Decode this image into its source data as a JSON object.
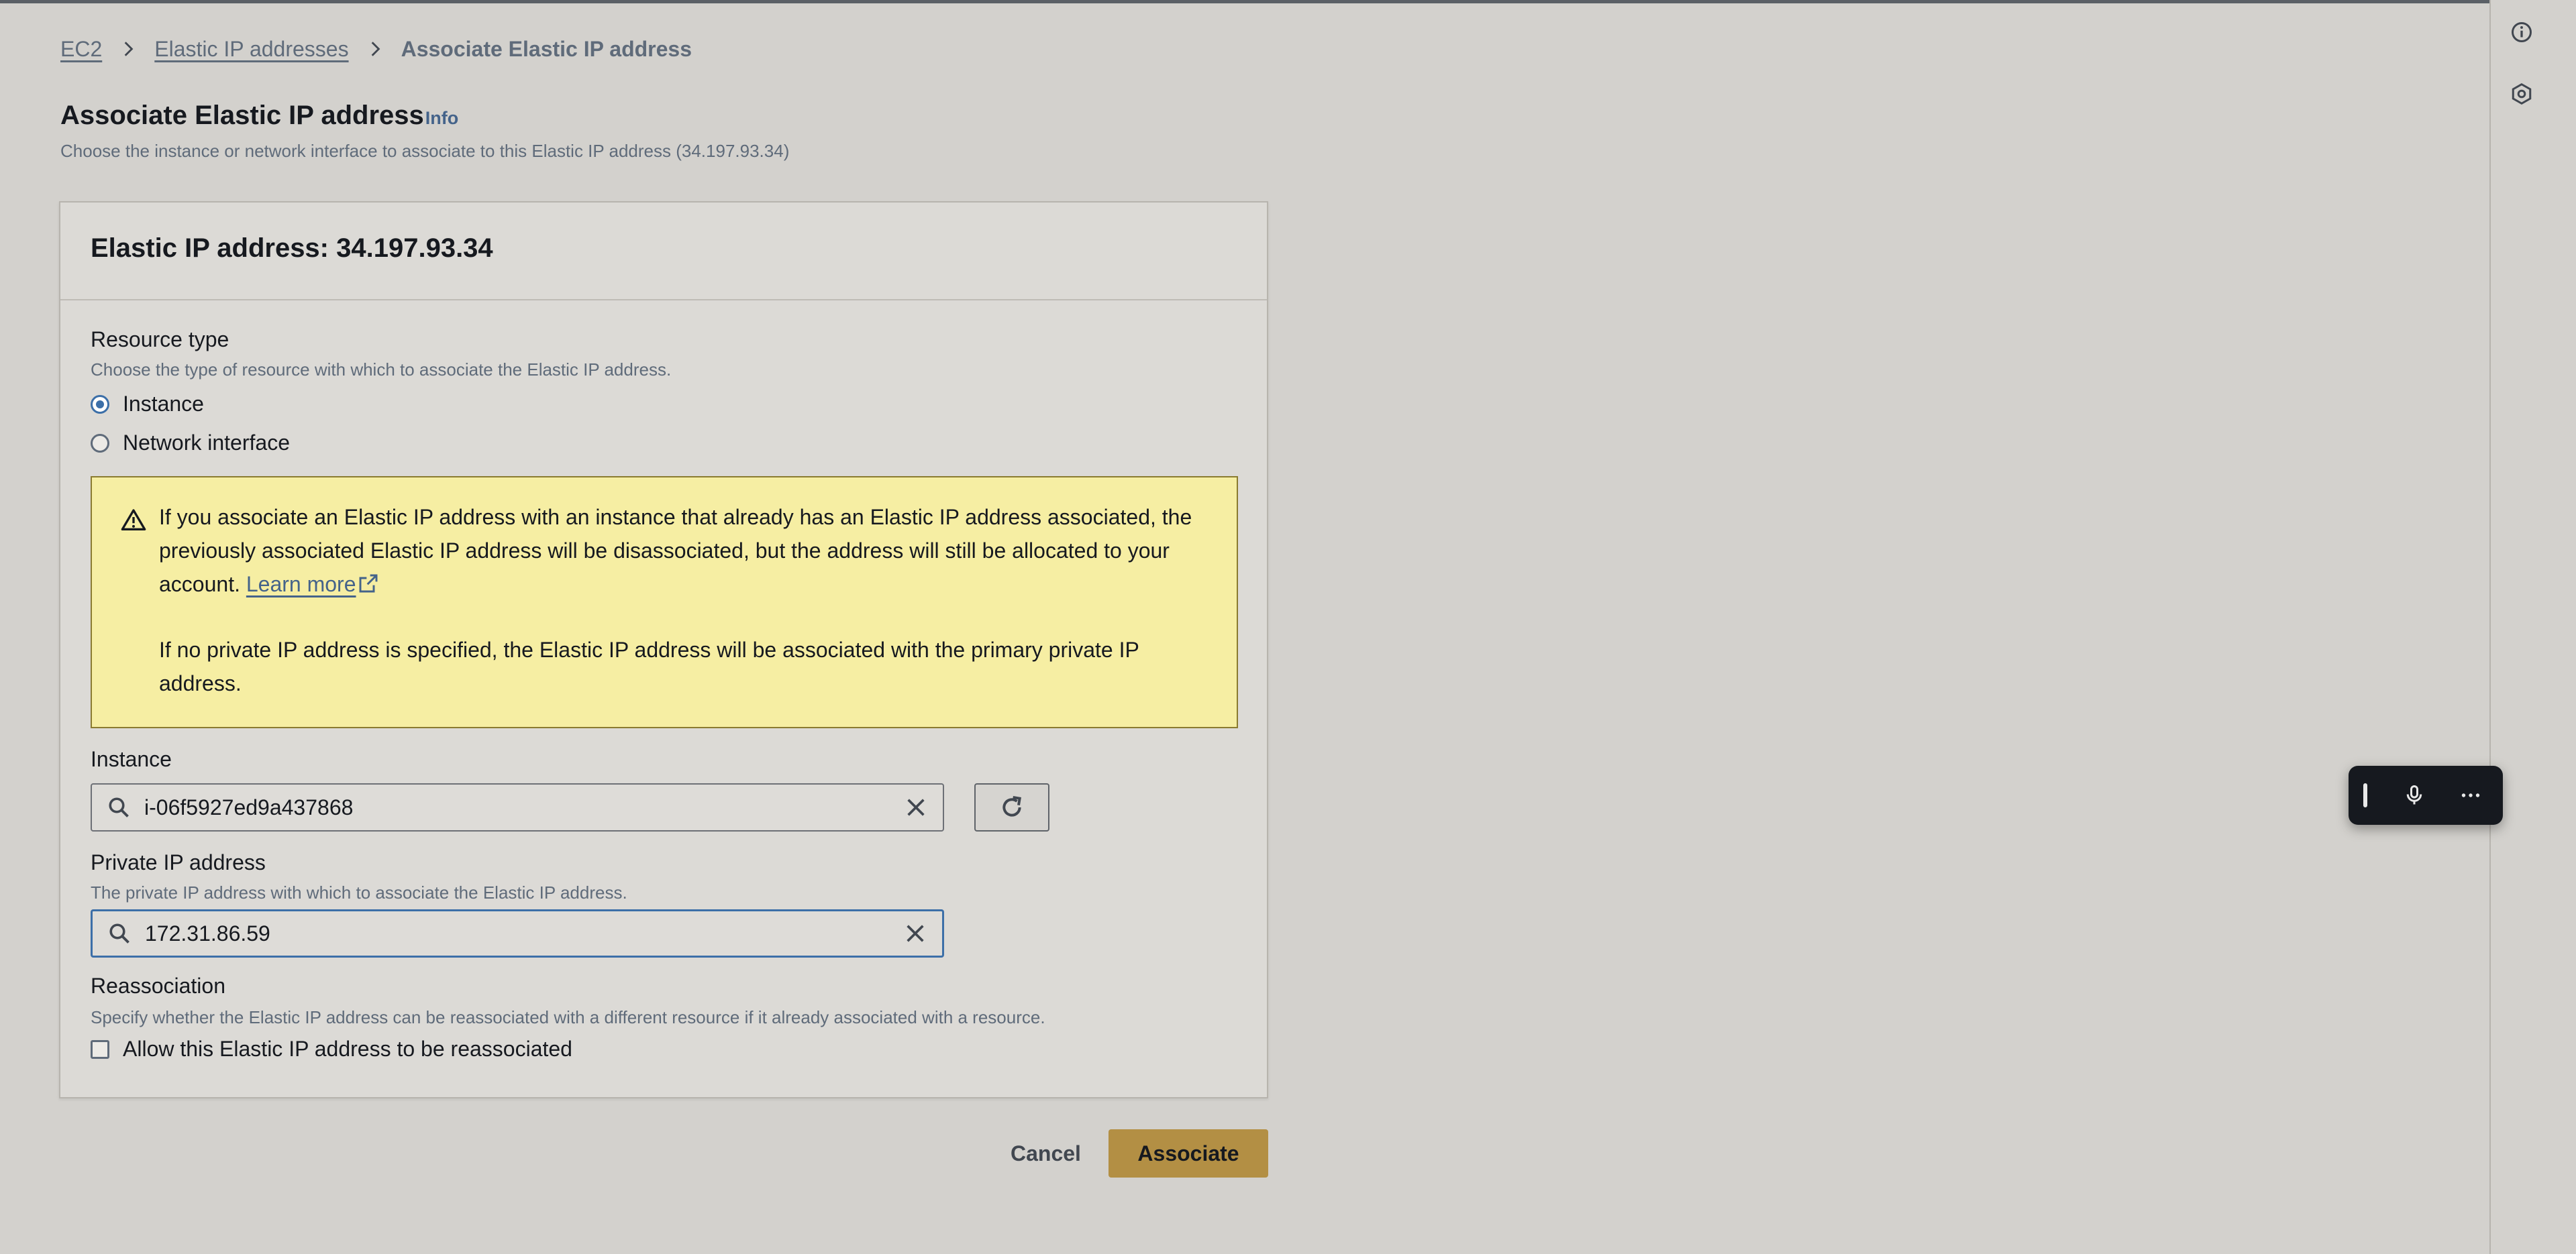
{
  "breadcrumb": {
    "items": [
      "EC2",
      "Elastic IP addresses"
    ],
    "current": "Associate Elastic IP address"
  },
  "page": {
    "title": "Associate Elastic IP address",
    "info": "Info",
    "description": "Choose the instance or network interface to associate to this Elastic IP address (34.197.93.34)"
  },
  "card": {
    "title": "Elastic IP address: 34.197.93.34"
  },
  "resource_type": {
    "label": "Resource type",
    "hint": "Choose the type of resource with which to associate the Elastic IP address.",
    "options": [
      {
        "label": "Instance",
        "selected": true
      },
      {
        "label": "Network interface",
        "selected": false
      }
    ]
  },
  "alert": {
    "text1": "If you associate an Elastic IP address with an instance that already has an Elastic IP address associated, the previously associated Elastic IP address will be disassociated, but the address will still be allocated to your account.",
    "link": "Learn more",
    "text2": "If no private IP address is specified, the Elastic IP address will be associated with the primary private IP address."
  },
  "instance": {
    "label": "Instance",
    "value": "i-06f5927ed9a437868"
  },
  "private_ip": {
    "label": "Private IP address",
    "hint": "The private IP address with which to associate the Elastic IP address.",
    "value": "172.31.86.59"
  },
  "reassociation": {
    "label": "Reassociation",
    "hint": "Specify whether the Elastic IP address can be reassociated with a different resource if it already associated with a resource.",
    "checkbox_label": "Allow this Elastic IP address to be reassociated",
    "checked": false
  },
  "actions": {
    "cancel": "Cancel",
    "associate": "Associate"
  },
  "colors": {
    "background": "#d3d1cd",
    "primary_button": "#b38f44",
    "alert_background": "#f6eea3",
    "link": "#44638a",
    "focus": "#3c6fa8"
  },
  "icons": {
    "rail": [
      "info-icon",
      "settings-hex-icon"
    ],
    "voice_bar": [
      "drag-handle-icon",
      "microphone-icon",
      "more-icon"
    ]
  }
}
